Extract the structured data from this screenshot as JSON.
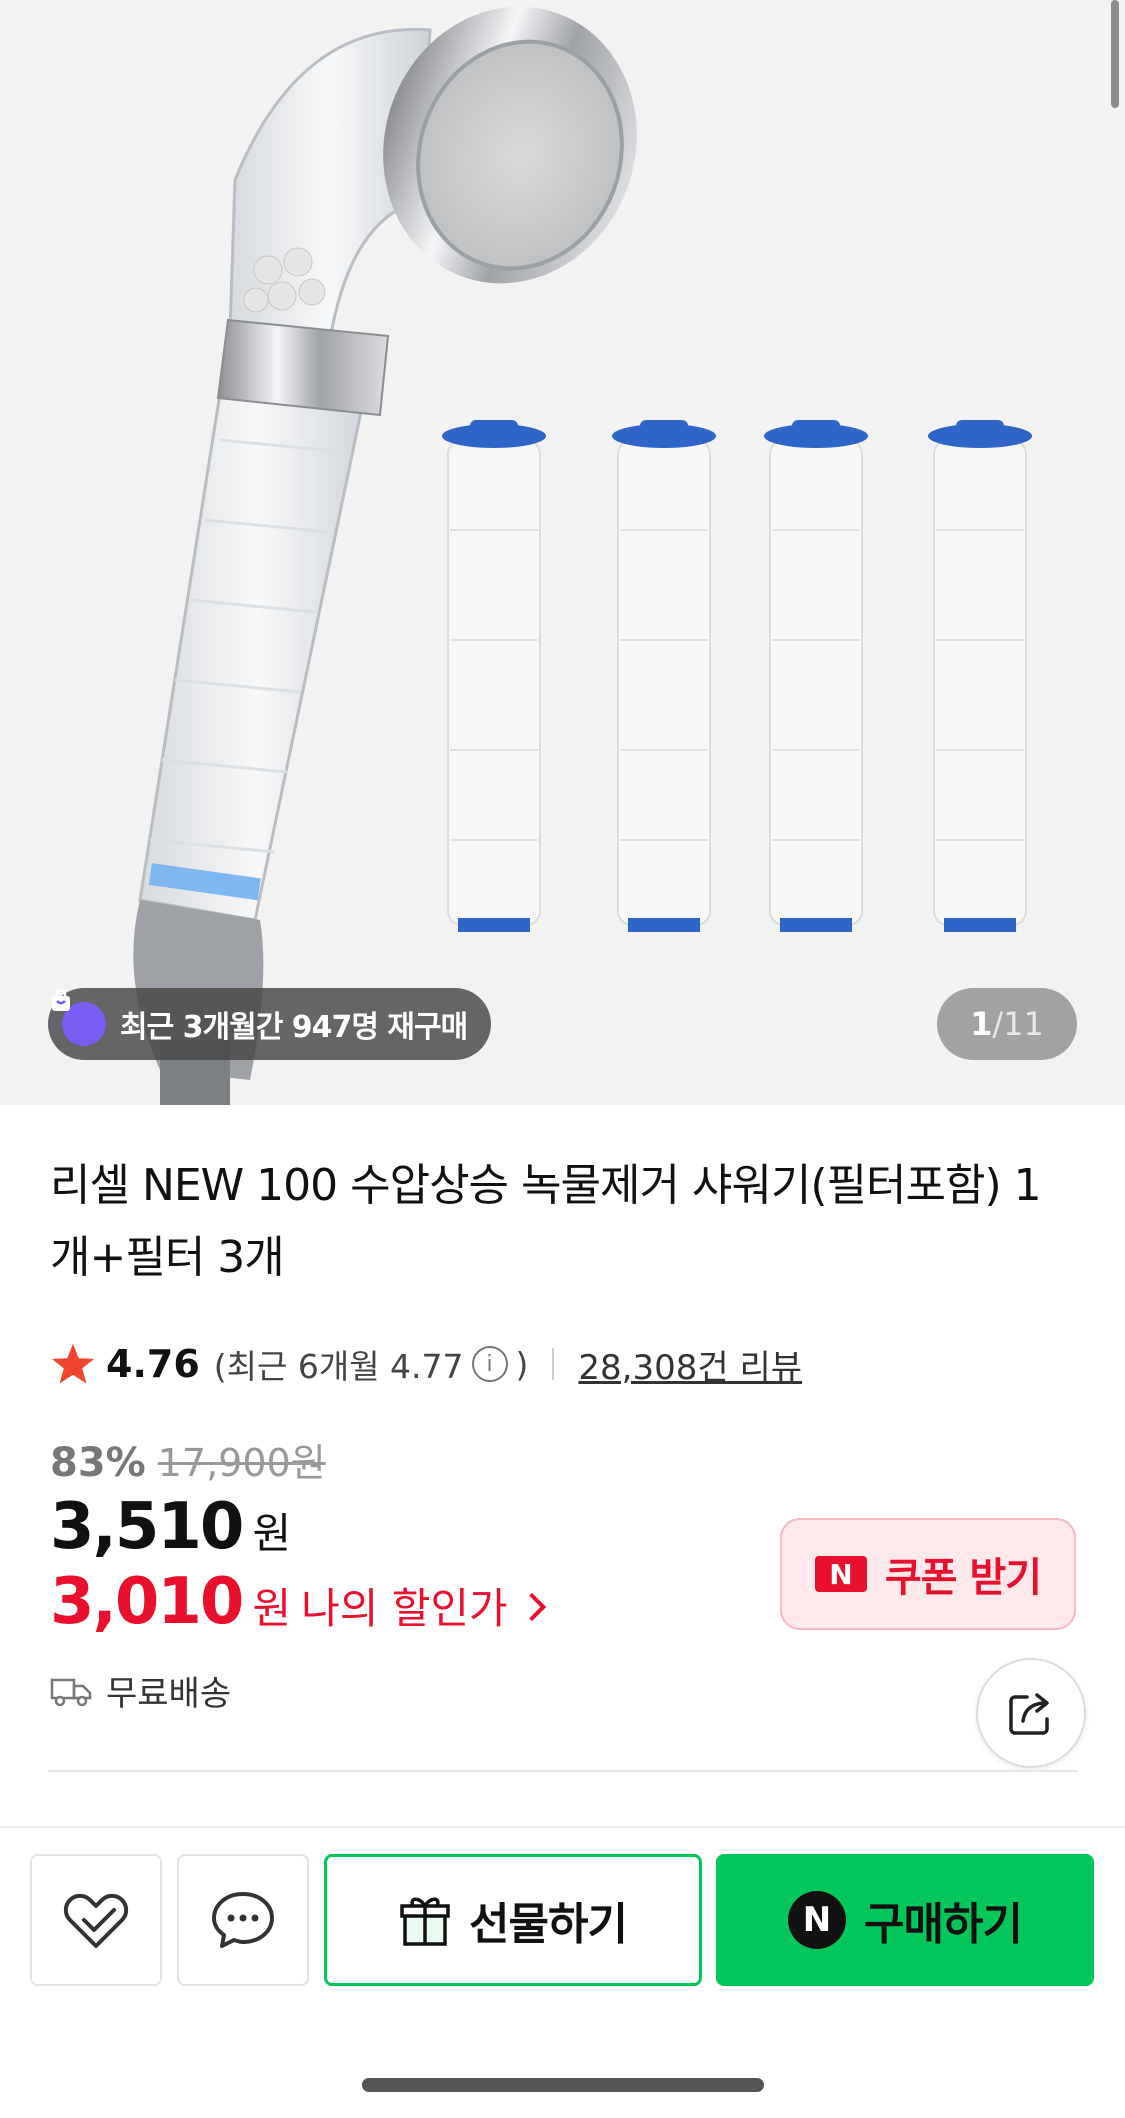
{
  "gallery": {
    "repurchase_badge": "최근 3개월간 947명 재구매",
    "current_page": "1",
    "separator": "/",
    "total_pages": "11"
  },
  "product": {
    "title": "리셀 NEW 100 수압상승 녹물제거 샤워기(필터포함) 1개+필터 3개",
    "rating": "4.76",
    "recent_rating_prefix": "(최근 6개월 4.77",
    "recent_rating_suffix": ")",
    "info_icon": "i",
    "review_count": "28,308건 리뷰",
    "discount_percent": "83%",
    "original_price": "17,900원",
    "price": "3,510",
    "price_unit": "원",
    "my_price": "3,010",
    "my_price_unit": "원",
    "my_price_label": "나의 할인가",
    "shipping": "무료배송"
  },
  "coupon": {
    "logo_text": "N",
    "label": "쿠폰 받기"
  },
  "bottom_bar": {
    "gift_label": "선물하기",
    "buy_logo": "N",
    "buy_label": "구매하기"
  },
  "icons": {
    "favorite": "heart-check-icon",
    "chat": "chat-bubble-icon",
    "share": "share-icon",
    "gift": "gift-icon",
    "shipping": "truck-icon",
    "star": "star-icon"
  },
  "colors": {
    "naver_green": "#03c75a",
    "sale_red": "#e8102c",
    "star_red": "#f0442f",
    "badge_purple": "#7a5cf5"
  }
}
